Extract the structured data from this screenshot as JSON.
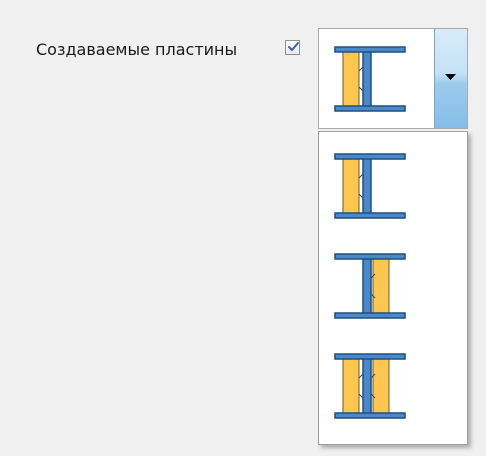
{
  "field": {
    "label": "Создаваемые пластины",
    "checkbox_checked": true
  },
  "combo": {
    "selected": "plates-left-icon",
    "options": [
      {
        "icon": "plates-left-icon"
      },
      {
        "icon": "plates-right-icon"
      },
      {
        "icon": "plates-both-icon"
      }
    ]
  },
  "colors": {
    "steel_blue": "#4a88c8",
    "steel_outline": "#1f4f7f",
    "plate_fill": "#fcc651",
    "plate_outline": "#7a5a1e",
    "combo_button": "#9ecbed"
  }
}
